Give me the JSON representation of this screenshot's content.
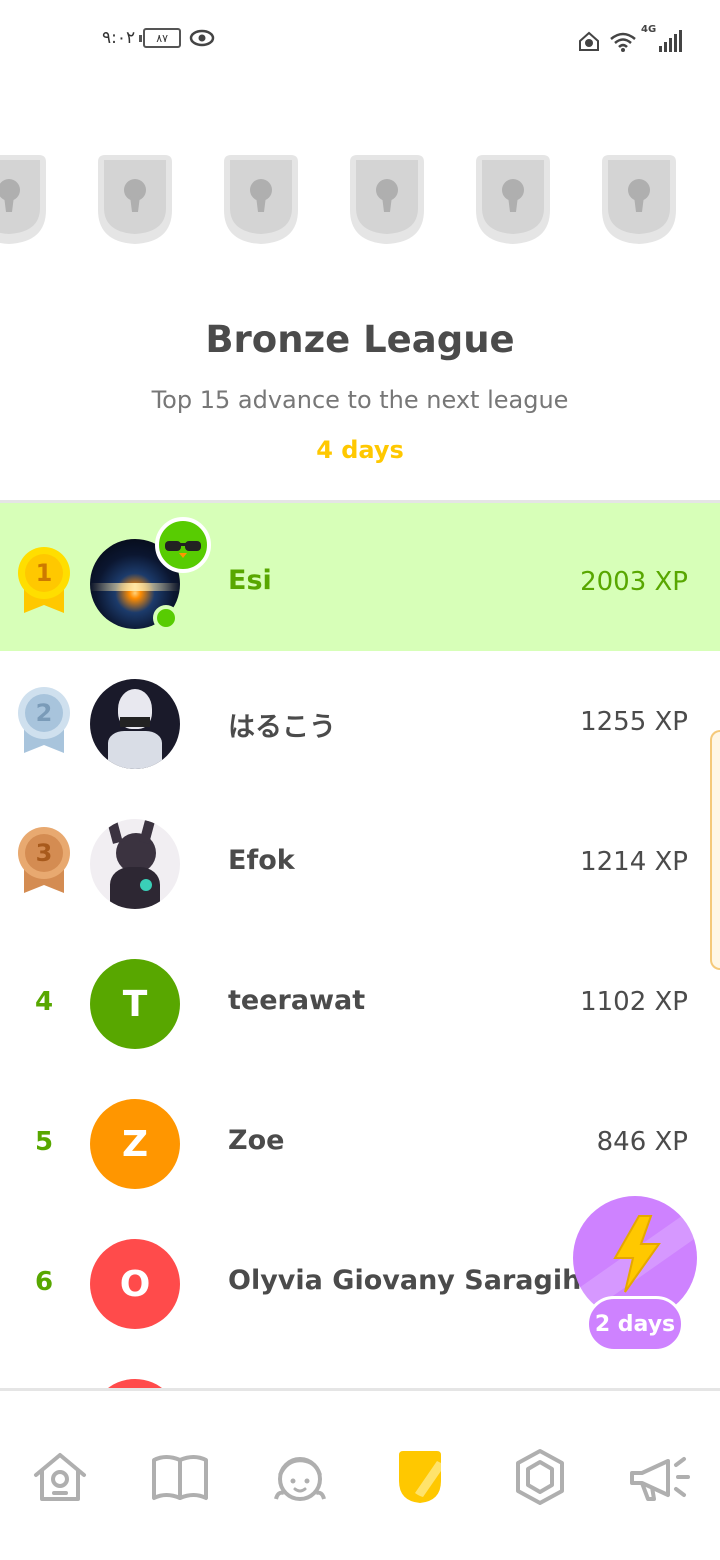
{
  "status_bar": {
    "time": "٩:٠٢",
    "battery": "٨٧",
    "network": "4G"
  },
  "league": {
    "title": "Bronze League",
    "subtitle": "Top 15 advance to the next league",
    "time_left": "4 days",
    "locked_badges": 6
  },
  "leaderboard": [
    {
      "rank": "1",
      "name": "Esi",
      "xp": "2003 XP",
      "avatar": "photo-earth",
      "current_user": true,
      "medal": "gold"
    },
    {
      "rank": "2",
      "name": "はるこう",
      "xp": "1255 XP",
      "avatar": "photo-anime",
      "medal": "silver"
    },
    {
      "rank": "3",
      "name": "Efok",
      "xp": "1214 XP",
      "avatar": "photo-creature",
      "medal": "bronze"
    },
    {
      "rank": "4",
      "name": "teerawat",
      "xp": "1102 XP",
      "avatar_letter": "T",
      "avatar_color": "#58a700"
    },
    {
      "rank": "5",
      "name": "Zoe",
      "xp": "846 XP",
      "avatar_letter": "Z",
      "avatar_color": "#ff9600"
    },
    {
      "rank": "6",
      "name": "Olyvia Giovany Saragih",
      "xp": "",
      "avatar_letter": "O",
      "avatar_color": "#ff4b4b"
    }
  ],
  "boost": {
    "label": "2 days",
    "icon": "lightning-bolt-icon"
  },
  "nav": {
    "items": [
      "home-icon",
      "book-icon",
      "character-icon",
      "league-shield-icon",
      "hexagon-icon",
      "megaphone-icon"
    ],
    "active": "league-shield-icon"
  },
  "colors": {
    "green": "#58a700",
    "highlight": "#d7ffb8",
    "gold": "#ffc800",
    "purple": "#ce82ff"
  }
}
